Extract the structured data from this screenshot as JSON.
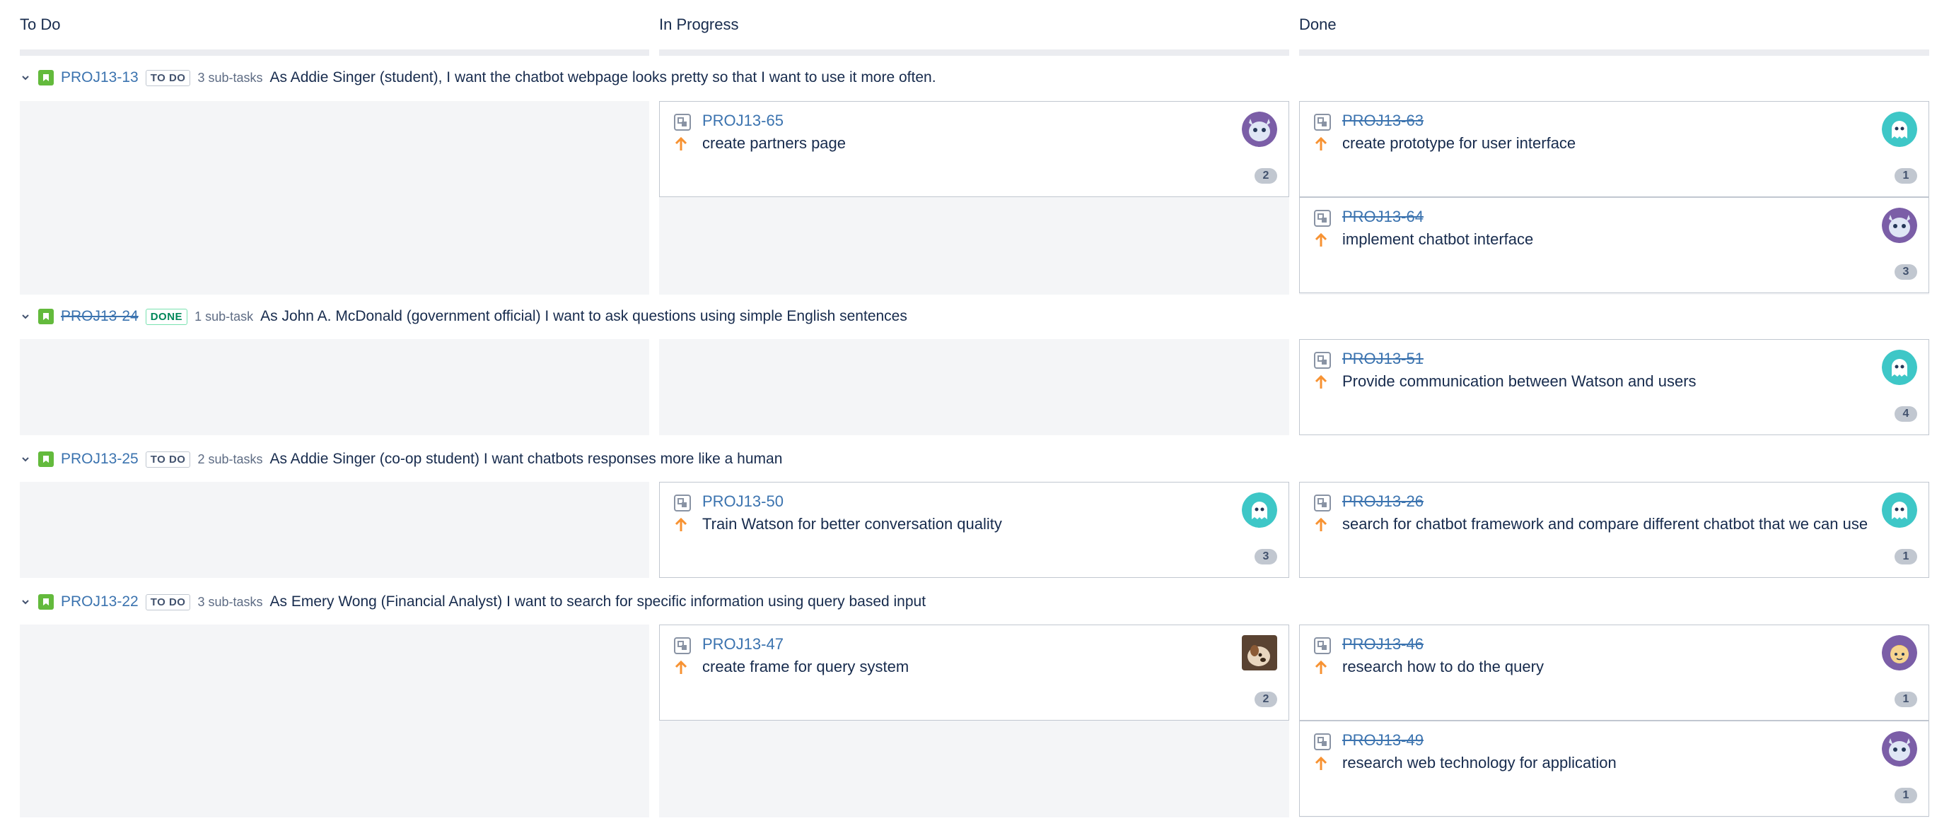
{
  "columns": [
    "To Do",
    "In Progress",
    "Done"
  ],
  "swimlanes": [
    {
      "key": "PROJ13-13",
      "status": "TO DO",
      "subtasks": "3 sub-tasks",
      "summary": "As Addie Singer (student), I want the chatbot webpage looks pretty so that I want to use it more often.",
      "in_progress": [
        {
          "key": "PROJ13-65",
          "title": "create partners page",
          "badge": "2",
          "avatar": "purple-owl-avatar"
        }
      ],
      "done": [
        {
          "key": "PROJ13-63",
          "title": "create prototype for user interface",
          "badge": "1",
          "avatar": "teal-ghost-avatar"
        },
        {
          "key": "PROJ13-64",
          "title": "implement chatbot interface",
          "badge": "3",
          "avatar": "purple-owl-avatar"
        }
      ]
    },
    {
      "key": "PROJ13-24",
      "status": "DONE",
      "subtasks": "1 sub-task",
      "summary": "As John A. McDonald (government official) I want to ask questions using simple English sentences",
      "in_progress": [],
      "done": [
        {
          "key": "PROJ13-51",
          "title": "Provide communication between Watson and users",
          "badge": "4",
          "avatar": "teal-ghost-avatar"
        }
      ]
    },
    {
      "key": "PROJ13-25",
      "status": "TO DO",
      "subtasks": "2 sub-tasks",
      "summary": "As Addie Singer (co-op student) I want chatbots responses more like a human",
      "in_progress": [
        {
          "key": "PROJ13-50",
          "title": "Train Watson for better conversation quality",
          "badge": "3",
          "avatar": "teal-ghost-avatar"
        }
      ],
      "done": [
        {
          "key": "PROJ13-26",
          "title": "search for chatbot framework and compare different chatbot that we can use",
          "badge": "1",
          "avatar": "teal-ghost-avatar"
        }
      ]
    },
    {
      "key": "PROJ13-22",
      "status": "TO DO",
      "subtasks": "3 sub-tasks",
      "summary": "As Emery Wong (Financial Analyst) I want to search for specific information using query based input",
      "in_progress": [
        {
          "key": "PROJ13-47",
          "title": "create frame for query system",
          "badge": "2",
          "avatar": "photo-dog-avatar"
        }
      ],
      "done": [
        {
          "key": "PROJ13-46",
          "title": "research how to do the query",
          "badge": "1",
          "avatar": "purple-face-avatar"
        },
        {
          "key": "PROJ13-49",
          "title": "research web technology for application",
          "badge": "1",
          "avatar": "purple-owl-avatar"
        }
      ]
    }
  ],
  "colors": {
    "link": "#3b73af",
    "story": "#63ba3c",
    "priority": "#f79232",
    "lane_bg": "#f4f5f7",
    "card_border": "#c1c7d0",
    "done_lozenge": "#00875a"
  }
}
